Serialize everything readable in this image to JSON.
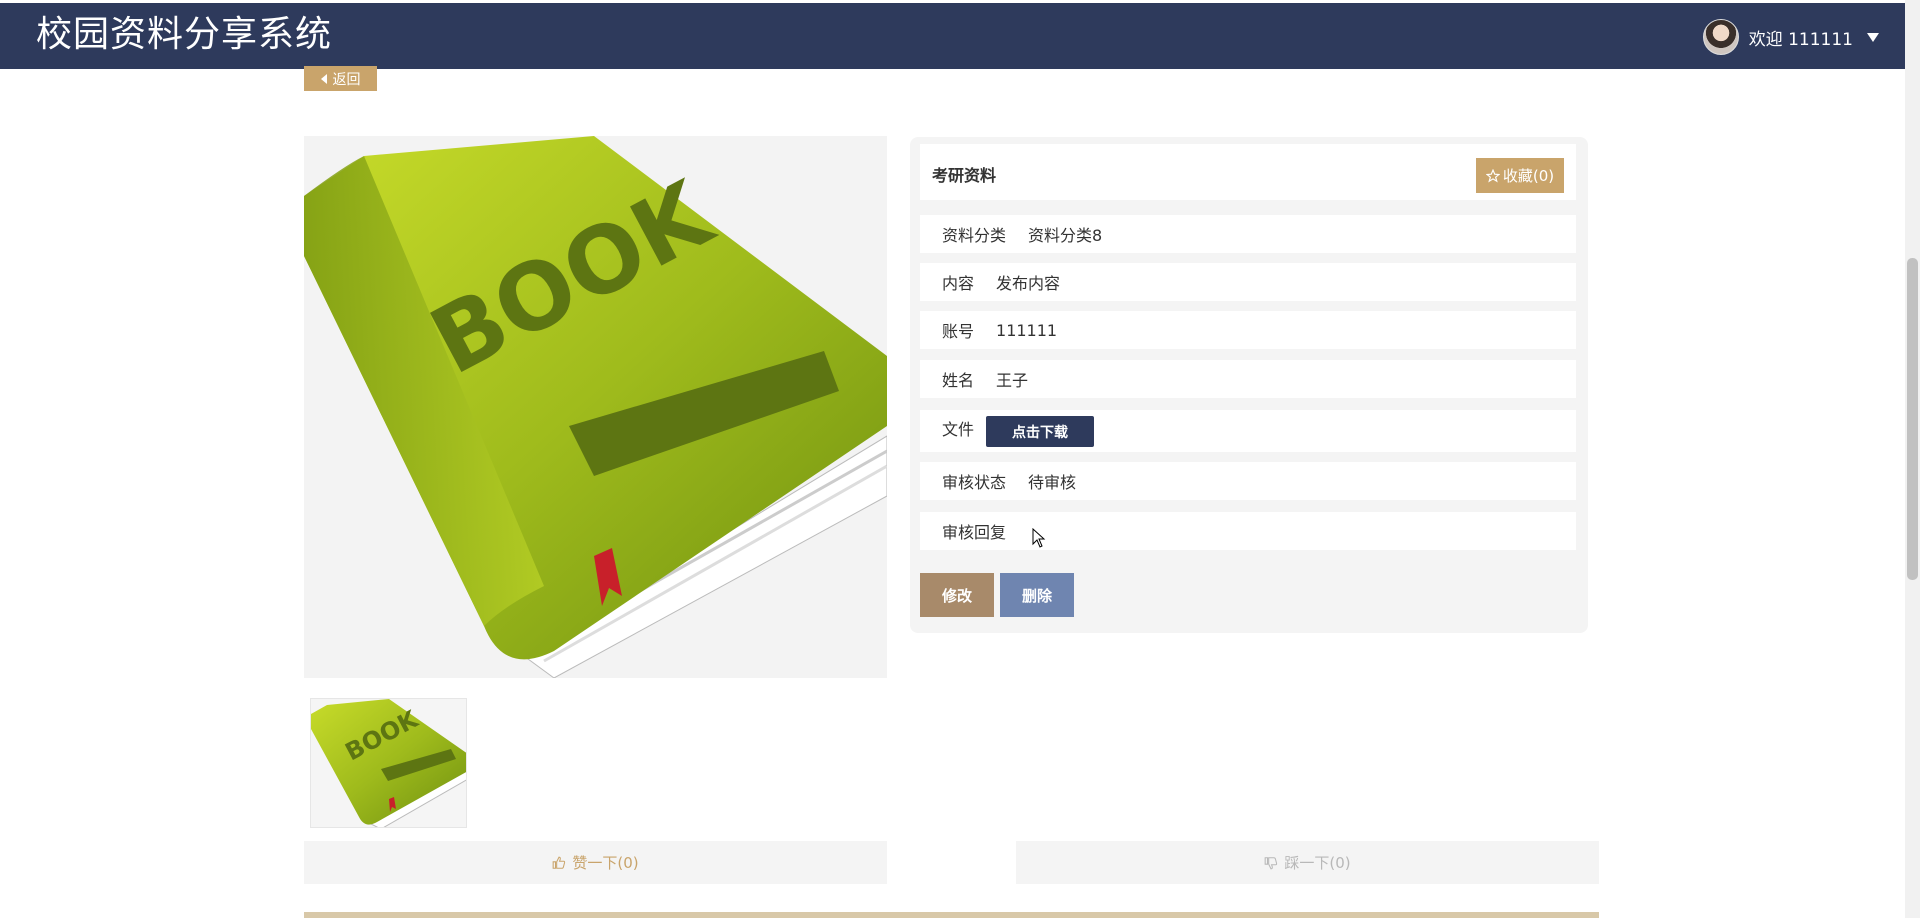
{
  "header": {
    "site_title": "校园资料分享系统",
    "welcome": "欢迎 111111"
  },
  "back": {
    "label": "返回"
  },
  "detail": {
    "title": "考研资料",
    "favorite_label": "收藏(0)",
    "fields": {
      "category_key": "资料分类",
      "category_value": "资料分类8",
      "content_key": "内容",
      "content_value": "发布内容",
      "account_key": "账号",
      "account_value": "111111",
      "name_key": "姓名",
      "name_value": "王子",
      "file_key": "文件",
      "file_button": "点击下载",
      "status_key": "审核状态",
      "status_value": "待审核",
      "reply_key": "审核回复",
      "reply_value": ""
    },
    "edit_label": "修改",
    "delete_label": "删除"
  },
  "votes": {
    "like_label": "赞一下(0)",
    "dislike_label": "踩一下(0)"
  },
  "image_text": "BOOK",
  "colors": {
    "header_bg": "#2e3a5c",
    "accent": "#c9a46b",
    "edit": "#a88a6a",
    "delete": "#6f85b0"
  }
}
